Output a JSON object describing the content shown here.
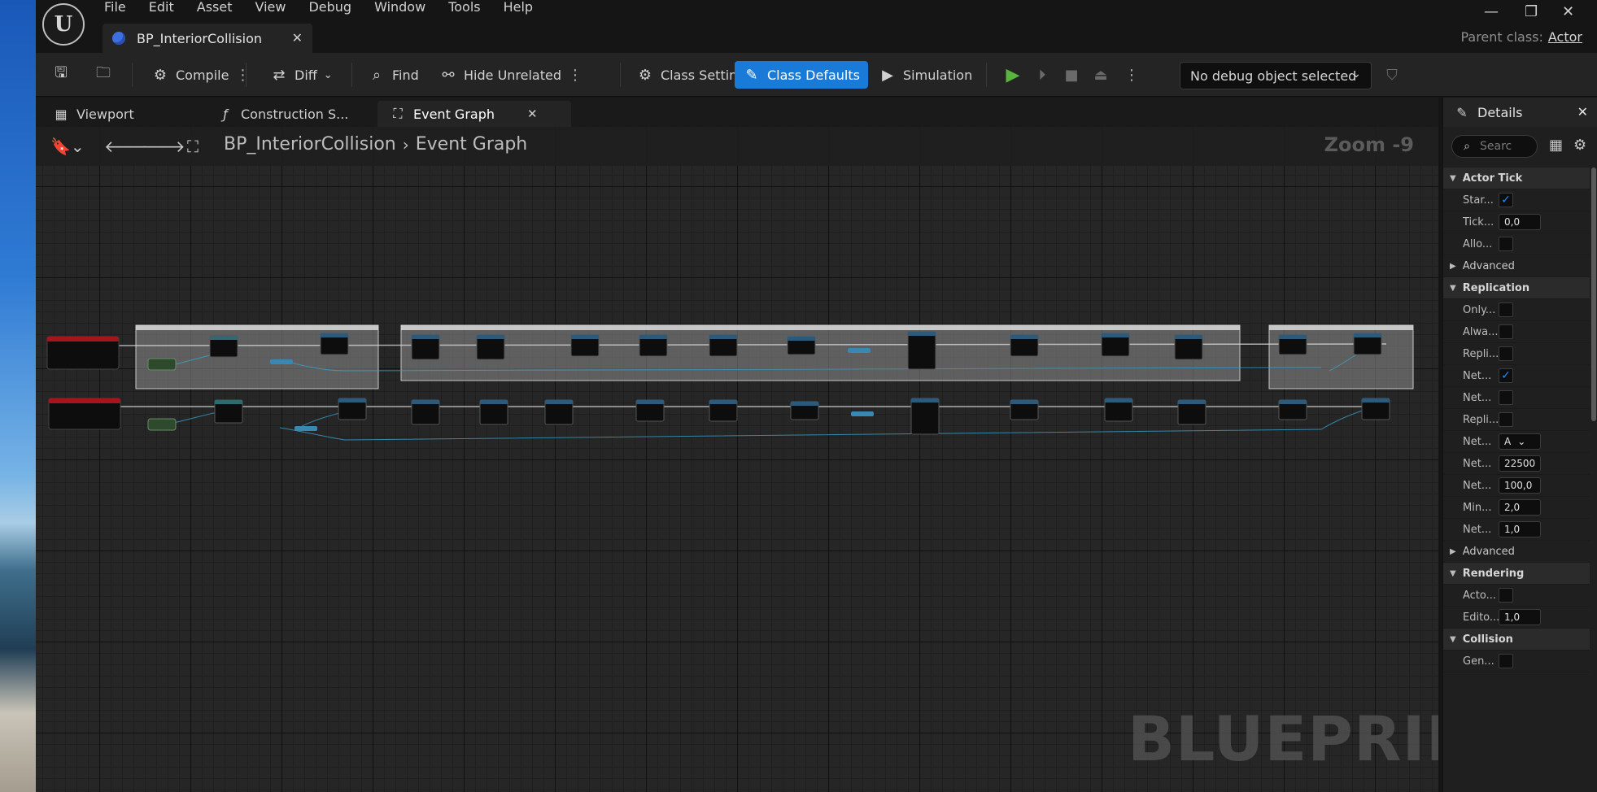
{
  "menu": [
    "File",
    "Edit",
    "Asset",
    "View",
    "Debug",
    "Window",
    "Tools",
    "Help"
  ],
  "document_tab": {
    "label": "BP_InteriorCollision"
  },
  "parent_class": {
    "label": "Parent class:",
    "value": "Actor"
  },
  "toolbar": {
    "compile": "Compile",
    "diff": "Diff",
    "find": "Find",
    "hide_unrelated": "Hide Unrelated",
    "class_settings": "Class Settings",
    "class_defaults": "Class Defaults",
    "simulation": "Simulation",
    "debug_object": "No debug object selected"
  },
  "editor_tabs": [
    {
      "label": "Viewport"
    },
    {
      "label": "Construction S..."
    },
    {
      "label": "Event Graph"
    }
  ],
  "graph": {
    "breadcrumb": [
      "BP_InteriorCollision",
      "Event Graph"
    ],
    "zoom": "Zoom -9",
    "watermark": "BLUEPRINT"
  },
  "details": {
    "title": "Details",
    "search_placeholder": "Searc",
    "sections": [
      {
        "title": "Actor Tick",
        "rows": [
          {
            "name": "Star...",
            "type": "check",
            "checked": true
          },
          {
            "name": "Tick...",
            "type": "num",
            "value": "0,0"
          },
          {
            "name": "Allo...",
            "type": "check",
            "checked": false
          }
        ],
        "advanced": "Advanced"
      },
      {
        "title": "Replication",
        "rows": [
          {
            "name": "Only...",
            "type": "check",
            "checked": false
          },
          {
            "name": "Alwa...",
            "type": "check",
            "checked": false
          },
          {
            "name": "Repli...",
            "type": "check",
            "checked": false
          },
          {
            "name": "Net...",
            "type": "check",
            "checked": true
          },
          {
            "name": "Net...",
            "type": "check",
            "checked": false
          },
          {
            "name": "Repli...",
            "type": "check",
            "checked": false
          },
          {
            "name": "Net...",
            "type": "combo",
            "value": "A"
          },
          {
            "name": "Net...",
            "type": "num",
            "value": "22500"
          },
          {
            "name": "Net...",
            "type": "num",
            "value": "100,0"
          },
          {
            "name": "Min...",
            "type": "num",
            "value": "2,0"
          },
          {
            "name": "Net...",
            "type": "num",
            "value": "1,0"
          }
        ],
        "advanced": "Advanced"
      },
      {
        "title": "Rendering",
        "rows": [
          {
            "name": "Acto...",
            "type": "check",
            "checked": false
          },
          {
            "name": "Edito...",
            "type": "num",
            "value": "1,0"
          }
        ]
      },
      {
        "title": "Collision",
        "rows": [
          {
            "name": "Gen...",
            "type": "check",
            "checked": false
          }
        ]
      }
    ]
  },
  "colors": {
    "accent": "#1a7ad8",
    "check": "#1f8cff",
    "play": "#58b43e",
    "event_node": "#a3161b"
  }
}
